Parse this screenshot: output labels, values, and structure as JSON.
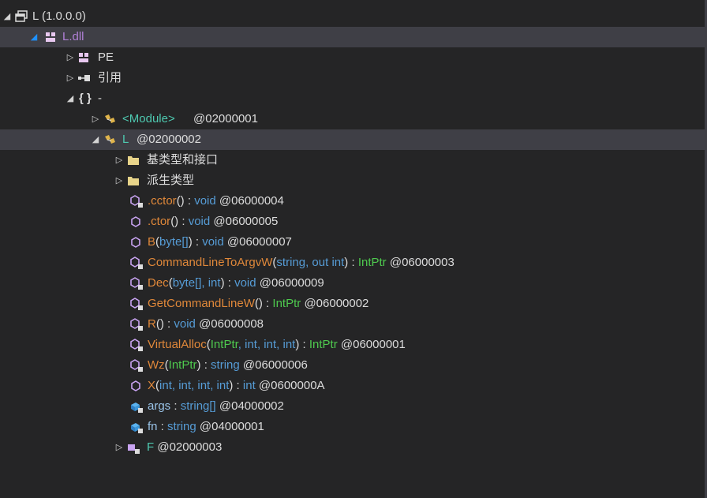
{
  "rows": [
    {
      "kind": "assembly",
      "label": "L (1.0.0.0)"
    },
    {
      "kind": "module",
      "label": "L.dll"
    },
    {
      "kind": "pe",
      "label": "PE"
    },
    {
      "kind": "refs",
      "label": "引用"
    },
    {
      "kind": "ns",
      "braces": "{ }",
      "label": "-"
    },
    {
      "kind": "class",
      "label": "<Module>",
      "token": "@02000001"
    },
    {
      "kind": "class",
      "label": "L",
      "token": "@02000002"
    },
    {
      "kind": "folder",
      "label": "基类型和接口"
    },
    {
      "kind": "folder",
      "label": "派生类型"
    },
    {
      "kind": "method",
      "name": ".cctor",
      "sig": "()",
      "ret": "void",
      "token": "@06000004"
    },
    {
      "kind": "method",
      "name": ".ctor",
      "sig": "()",
      "ret": "void",
      "token": "@06000005"
    },
    {
      "kind": "method",
      "name": "B",
      "sig_open": "(",
      "param": "byte[]",
      "sig_close": ")",
      "ret": "void",
      "token": "@06000007"
    },
    {
      "kind": "method",
      "name": "CommandLineToArgvW",
      "sig_open": "(",
      "param": "string, out int",
      "sig_close": ")",
      "ret": "IntPtr",
      "token": "@06000003"
    },
    {
      "kind": "method",
      "name": "Dec",
      "sig_open": "(",
      "param": "byte[], int",
      "sig_close": ")",
      "ret": "void",
      "token": "@06000009"
    },
    {
      "kind": "method",
      "name": "GetCommandLineW",
      "sig": "()",
      "ret": "IntPtr",
      "token": "@06000002"
    },
    {
      "kind": "method",
      "name": "R",
      "sig": "()",
      "ret": "void",
      "token": "@06000008"
    },
    {
      "kind": "method",
      "name": "VirtualAlloc",
      "sig_open": "(",
      "param1": "IntPtr",
      "param": ", int, int, int",
      "sig_close": ")",
      "ret": "IntPtr",
      "token": "@06000001"
    },
    {
      "kind": "method",
      "name": "Wz",
      "sig_open": "(",
      "param1": "IntPtr",
      "sig_close": ")",
      "ret": "string",
      "token": "@06000006"
    },
    {
      "kind": "method",
      "name": "X",
      "sig_open": "(",
      "param": "int, int, int, int",
      "sig_close": ")",
      "ret": "int",
      "token": "@0600000A"
    },
    {
      "kind": "field",
      "name": "args",
      "ret": "string[]",
      "token": "@04000002"
    },
    {
      "kind": "field",
      "name": "fn",
      "ret": "string",
      "token": "@04000001"
    },
    {
      "kind": "class",
      "label": "F",
      "token": "@02000003"
    }
  ],
  "colors": {
    "background": "#252526",
    "selected_row": "#3f3f46",
    "type_keyword": "#569cd6",
    "struct_type": "#4ec94e",
    "method_name": "#e0883a",
    "module_name": "#b180d7",
    "class_name": "#4ec9b0"
  },
  "icons": {
    "expanded": "triangle-down-icon",
    "collapsed": "triangle-right-icon",
    "assembly": "assembly-icon",
    "module": "module-icon",
    "pe": "pe-icon",
    "references": "references-icon",
    "namespace": "namespace-icon",
    "class": "class-icon",
    "folder": "folder-icon",
    "method": "method-icon",
    "field": "field-icon"
  }
}
